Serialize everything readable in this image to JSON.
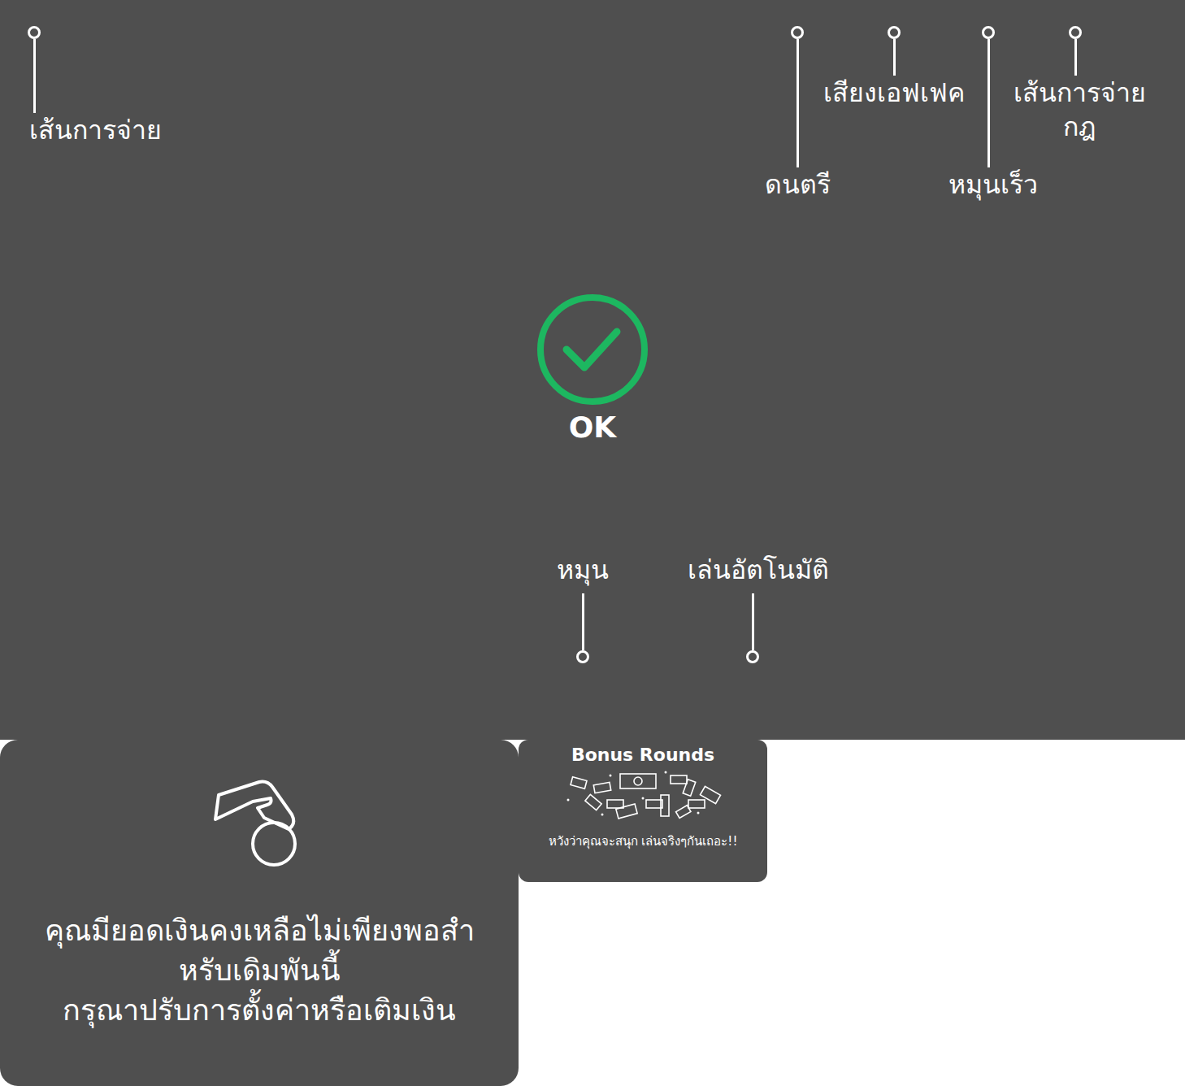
{
  "annotations": [
    {
      "lines": [
        "เส้นการจ่าย"
      ]
    },
    {
      "lines": [
        "ดนตรี"
      ]
    },
    {
      "lines": [
        "เสียงเอฟเฟค"
      ]
    },
    {
      "lines": [
        "หมุนเร็ว"
      ]
    },
    {
      "lines": [
        "เส้นการจ่าย",
        "กฎ"
      ]
    },
    {
      "lines": [
        "หมุน"
      ]
    },
    {
      "lines": [
        "เล่นอัตโนมัติ"
      ]
    }
  ],
  "status": {
    "label": "OK"
  },
  "insufficient_balance": {
    "lines": [
      "คุณมียอดเงินคงเหลือไม่เพียงพอสำ",
      "หรับเดิมพันนี้",
      "กรุณาปรับการตั้งค่าหรือเติมเงิน"
    ]
  },
  "bonus": {
    "title": "Bonus Rounds",
    "caption": "หวังว่าคุณจะสนุก เล่นจริงๆกันเถอะ!!"
  }
}
